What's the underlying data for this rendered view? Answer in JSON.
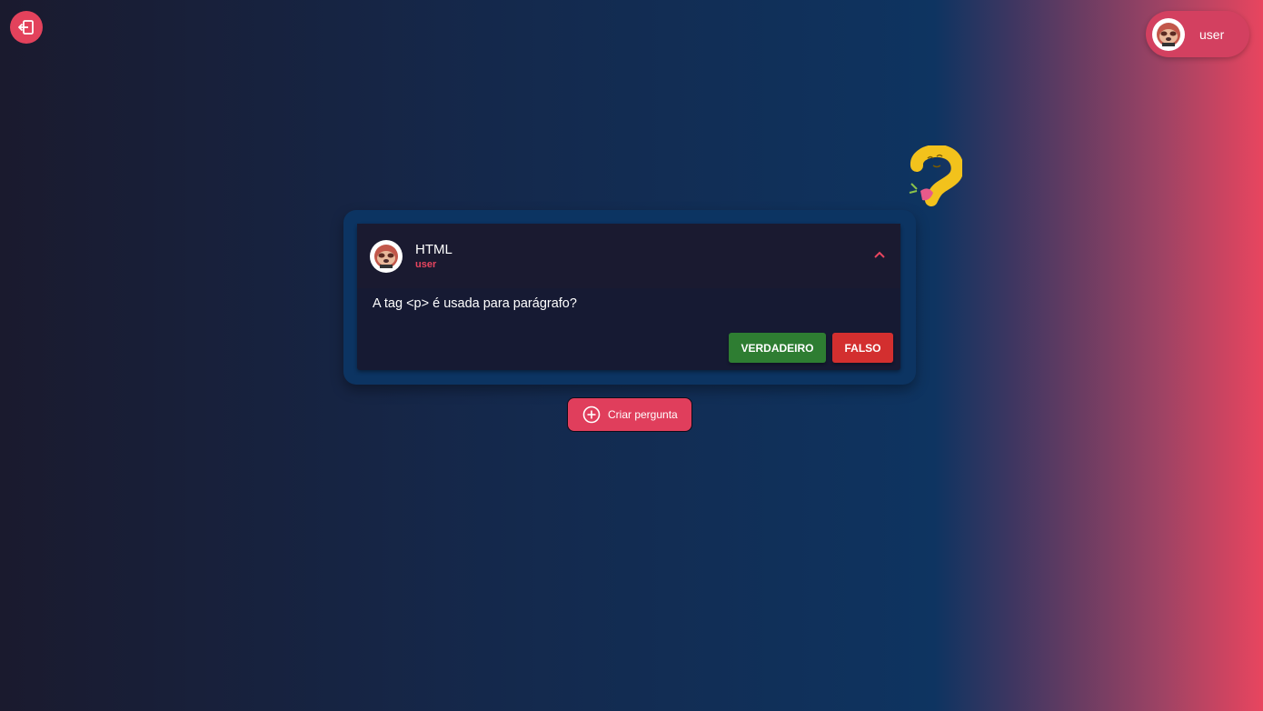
{
  "header": {
    "logout_icon": "logout-icon",
    "user_name": "user",
    "avatar_icon": "sloth-avatar-icon"
  },
  "question": {
    "title": "HTML",
    "author": "user",
    "text": "A tag <p> é usada para parágrafo?",
    "collapse_icon": "chevron-up-icon",
    "true_label": "VERDADEIRO",
    "false_label": "FALSO"
  },
  "actions": {
    "create_label": "Criar pergunta",
    "create_icon": "plus-circle-icon"
  },
  "decoration": {
    "sticker_icon": "question-mark-sticker-icon"
  },
  "colors": {
    "accent": "#e3425c",
    "true_button": "#2e7d32",
    "false_button": "#d32f2f",
    "card_outer": "#0c3462",
    "card_inner": "#161a33"
  }
}
